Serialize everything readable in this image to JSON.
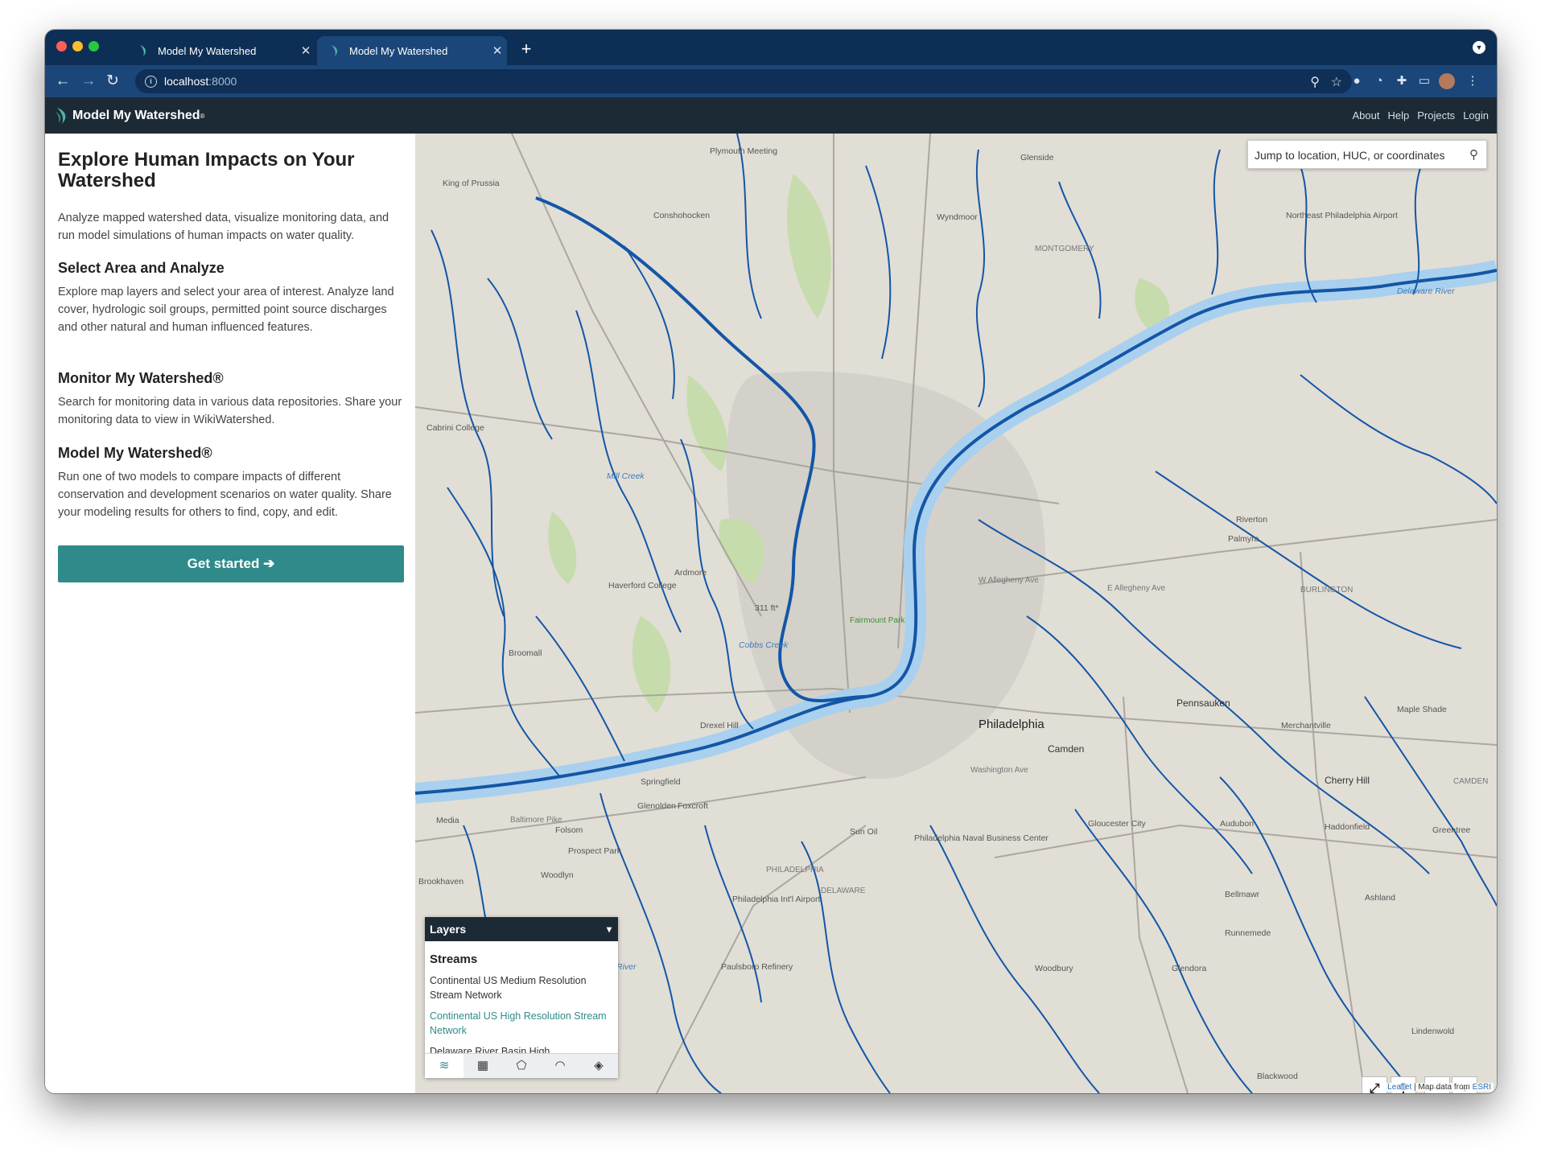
{
  "browser": {
    "tabs": [
      {
        "title": "Model My Watershed",
        "active": false
      },
      {
        "title": "Model My Watershed",
        "active": true
      }
    ],
    "new_tab": "+",
    "url_host": "localhost",
    "url_port": ":8000"
  },
  "app": {
    "brand": "Model My Watershed",
    "brand_mark": "®",
    "nav": [
      "About",
      "Help",
      "Projects",
      "Login"
    ]
  },
  "panel": {
    "title": "Explore Human Impacts on Your Watershed",
    "intro": "Analyze mapped watershed data, visualize monitoring data, and run model simulations of human impacts on water quality.",
    "sections": [
      {
        "heading": "Select Area and Analyze",
        "body": "Explore map layers and select your area of interest. Analyze land cover, hydrologic soil groups, permitted point source discharges and other natural and human influenced features."
      },
      {
        "heading": "Monitor My Watershed®",
        "body": "Search for monitoring data in various data repositories. Share your monitoring data to view in WikiWatershed."
      },
      {
        "heading": "Model My Watershed®",
        "body": "Run one of two models to compare impacts of different conservation and development scenarios on water quality. Share your modeling results for others to find, copy, and edit."
      }
    ],
    "cta": "Get started ➔"
  },
  "map": {
    "search_placeholder": "Jump to location, HUC, or coordinates",
    "labels": {
      "philadelphia": "Philadelphia",
      "camden": "Camden",
      "pennsauken": "Pennsauken",
      "cherry_hill": "Cherry Hill",
      "plymouth_meeting": "Plymouth Meeting",
      "conshohocken": "Conshohocken",
      "king_of_prussia": "King of Prussia",
      "wyndmoor": "Wyndmoor",
      "glenside": "Glenside",
      "ardmore": "Ardmore",
      "broomall": "Broomall",
      "springfield": "Springfield",
      "media": "Media",
      "drexel_hill": "Drexel Hill",
      "folsom": "Folsom",
      "prospect_park": "Prospect Park",
      "woodlyn": "Woodlyn",
      "glenolden": "Glenolden",
      "foxcroft": "Foxcroft",
      "brookhaven": "Brookhaven",
      "riverton": "Riverton",
      "palmyra": "Palmyra",
      "merchantville": "Merchantville",
      "maple_shade": "Maple Shade",
      "haddonfield": "Haddonfield",
      "audubon": "Audubon",
      "gloucester_city": "Gloucester City",
      "bellmawr": "Bellmawr",
      "runnemede": "Runnemede",
      "woodbury": "Woodbury",
      "glendora": "Glendora",
      "ashland": "Ashland",
      "greentree": "Greentree",
      "lindenwold": "Lindenwold",
      "blackwood": "Blackwood",
      "paulsboro": "Paulsboro Refinery",
      "airport": "Philadelphia Int'l Airport",
      "ne_airport": "Northeast Philadelphia Airport",
      "navy": "Philadelphia Naval Business Center",
      "delaware_river": "Delaware River",
      "river": "River",
      "montgomery": "MONTGOMERY",
      "philadelphia_co": "PHILADELPHIA",
      "delaware_co": "DELAWARE",
      "camden_co": "CAMDEN",
      "burlington_co": "BURLINGTON",
      "allegheny_w": "W Allegheny Ave",
      "allegheny_e": "E Allegheny Ave",
      "washington": "Washington Ave",
      "baltimore": "Baltimore Pike",
      "mill_creek": "Mill Creek",
      "cobbs_creek": "Cobbs Creek",
      "elevation": "311 ft*",
      "fairmount": "Fairmount Park",
      "haverford": "Haverford College",
      "cabrini": "Cabrini College",
      "sun_oil": "Sun Oil"
    },
    "layers": {
      "title": "Layers",
      "section": "Streams",
      "items": [
        {
          "label": "Continental US Medium Resolution Stream Network",
          "active": false
        },
        {
          "label": "Continental US High Resolution Stream Network",
          "active": true
        },
        {
          "label": "Delaware River Basin High",
          "active": false
        }
      ]
    },
    "controls": [
      "⤢",
      "⚲",
      "−",
      "+"
    ],
    "attribution": {
      "leaflet": "Leaflet",
      "sep": " | Map data from ",
      "esri": "ESRI"
    }
  }
}
